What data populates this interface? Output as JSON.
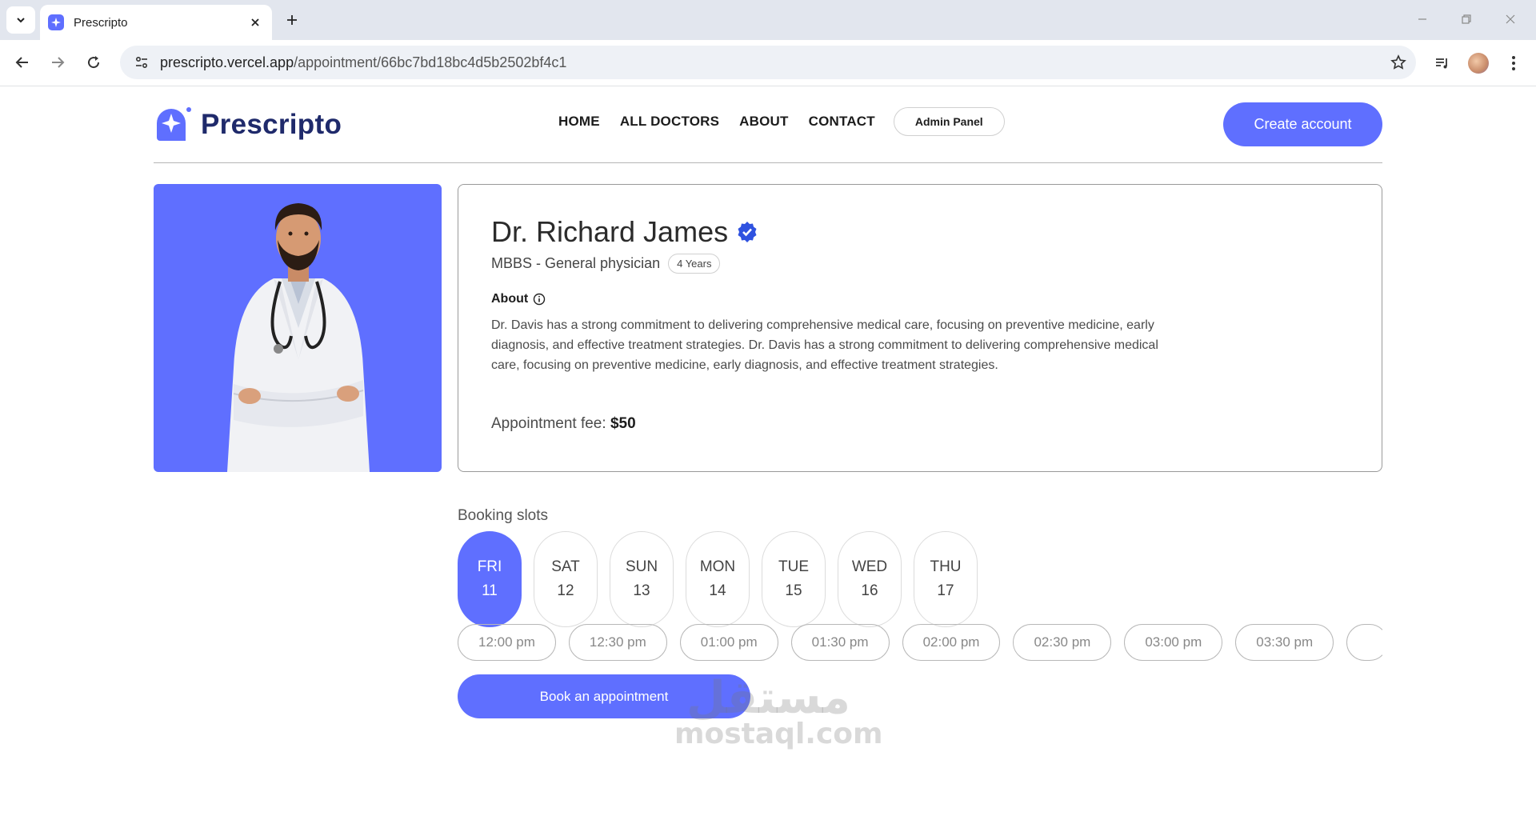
{
  "browser": {
    "tab_title": "Prescripto",
    "url_host": "prescripto.vercel.app",
    "url_path": "/appointment/66bc7bd18bc4d5b2502bf4c1",
    "icons": [
      "tab-list-icon",
      "favicon-icon",
      "close-icon",
      "plus-icon",
      "minimize-icon",
      "restore-icon",
      "window-close-icon",
      "back-icon",
      "forward-icon",
      "reload-icon",
      "site-info-icon",
      "star-icon",
      "media-icon",
      "profile-avatar",
      "kebab-menu-icon"
    ]
  },
  "header": {
    "logo_text": "Prescripto",
    "nav": [
      "HOME",
      "ALL DOCTORS",
      "ABOUT",
      "CONTACT"
    ],
    "admin_label": "Admin Panel",
    "create_label": "Create account"
  },
  "doctor": {
    "name": "Dr. Richard James",
    "degree": "MBBS - General physician",
    "experience": "4 Years",
    "about_label": "About",
    "about_text": "Dr. Davis has a strong commitment to delivering comprehensive medical care, focusing on preventive medicine, early diagnosis, and effective treatment strategies. Dr. Davis has a strong commitment to delivering comprehensive medical care, focusing on preventive medicine, early diagnosis, and effective treatment strategies.",
    "fee_label": "Appointment fee:",
    "fee_value": "$50"
  },
  "booking": {
    "title": "Booking slots",
    "days": [
      {
        "day": "FRI",
        "date": "11",
        "active": true
      },
      {
        "day": "SAT",
        "date": "12",
        "active": false
      },
      {
        "day": "SUN",
        "date": "13",
        "active": false
      },
      {
        "day": "MON",
        "date": "14",
        "active": false
      },
      {
        "day": "TUE",
        "date": "15",
        "active": false
      },
      {
        "day": "WED",
        "date": "16",
        "active": false
      },
      {
        "day": "THU",
        "date": "17",
        "active": false
      }
    ],
    "times": [
      "12:00 pm",
      "12:30 pm",
      "01:00 pm",
      "01:30 pm",
      "02:00 pm",
      "02:30 pm",
      "03:00 pm",
      "03:30 pm",
      ""
    ],
    "book_label": "Book an appointment"
  },
  "watermark": {
    "arabic": "مستقل",
    "latin": "mostaql.com"
  },
  "colors": {
    "primary": "#5f6fff",
    "logo_text": "#1f2a6b",
    "verified": "#2f52e0"
  }
}
